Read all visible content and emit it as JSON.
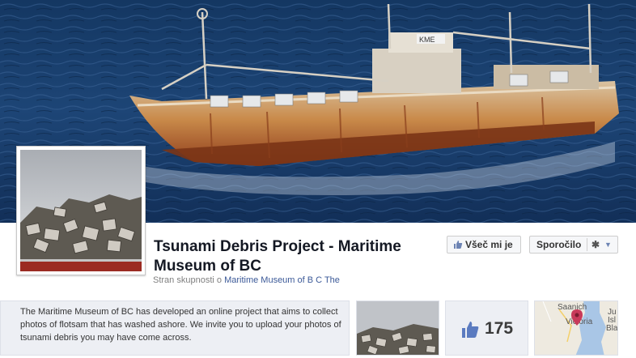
{
  "page": {
    "title": "Tsunami Debris Project - Maritime Museum of BC",
    "subtitle_prefix": "Stran skupnosti o ",
    "subtitle_link": "Maritime Museum of B C The"
  },
  "cover": {
    "ship_marking": "KME"
  },
  "actions": {
    "like_label": "Všeč mi je",
    "message_label": "Sporočilo",
    "gear_icon": "gear-icon",
    "caret_icon": "chevron-down-icon"
  },
  "about": {
    "text": "The Maritime Museum of BC has developed an online project that aims to collect photos of flotsam that has washed ashore. We invite you to upload your photos of tsunami debris you may have come across."
  },
  "likes_tile": {
    "count": "175",
    "icon": "thumbs-up-icon"
  },
  "map_tile": {
    "label_saanich": "Saanich",
    "label_victoria": "Victoria",
    "label_edge1": "Ju",
    "label_edge2": "Isl",
    "label_edge3": "Bla"
  },
  "colors": {
    "brand_blue": "#3b5998",
    "tile_bg": "#edeff4",
    "ocean": "#1b3a66",
    "rust": "#b5652a",
    "map_pin": "#c83a5a"
  }
}
